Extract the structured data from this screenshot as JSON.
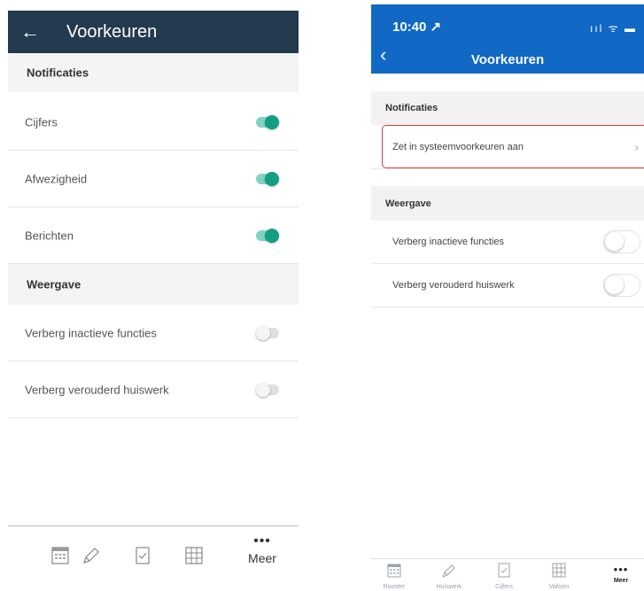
{
  "android": {
    "back_glyph": "←",
    "title": "Voorkeuren",
    "sections": [
      {
        "title": "Notificaties",
        "items": [
          {
            "label": "Cijfers",
            "toggle_on": true
          },
          {
            "label": "Afwezigheid",
            "toggle_on": true
          },
          {
            "label": "Berichten",
            "toggle_on": true
          }
        ]
      },
      {
        "title": "Weergave",
        "items": [
          {
            "label": "Verberg inactieve functies",
            "toggle_on": false
          },
          {
            "label": "Verberg verouderd huiswerk",
            "toggle_on": false
          }
        ]
      }
    ],
    "bottom_nav": {
      "icons": [
        "calendar-icon",
        "pencil-icon",
        "checklist-icon",
        "grid-icon"
      ],
      "more_glyph": "•••",
      "more_label": "Meer"
    },
    "colors": {
      "header": "#233a4f",
      "toggle_on": "#129e80"
    }
  },
  "ios": {
    "time": "10:40",
    "location_glyph": "↗",
    "status_glyphs": "ııl ᯤ ▬",
    "back_glyph": "‹",
    "title": "Voorkeuren",
    "notifications": {
      "title": "Notificaties",
      "item_label": "Zet in systeemvoorkeuren aan",
      "chevron": "›"
    },
    "weergave": {
      "title": "Weergave",
      "items": [
        {
          "label": "Verberg inactieve functies",
          "toggle_on": false
        },
        {
          "label": "Verberg verouderd huiswerk",
          "toggle_on": false
        }
      ]
    },
    "tabs": [
      {
        "label": "Rooster",
        "icon": "calendar-icon"
      },
      {
        "label": "Huiswerk",
        "icon": "pencil-icon"
      },
      {
        "label": "Cijfers",
        "icon": "checklist-icon"
      },
      {
        "label": "Vakken",
        "icon": "grid-icon"
      },
      {
        "label": "Meer",
        "icon": "more-icon",
        "glyph": "•••"
      }
    ],
    "colors": {
      "header": "#1168c5",
      "highlight": "#e53935"
    }
  }
}
